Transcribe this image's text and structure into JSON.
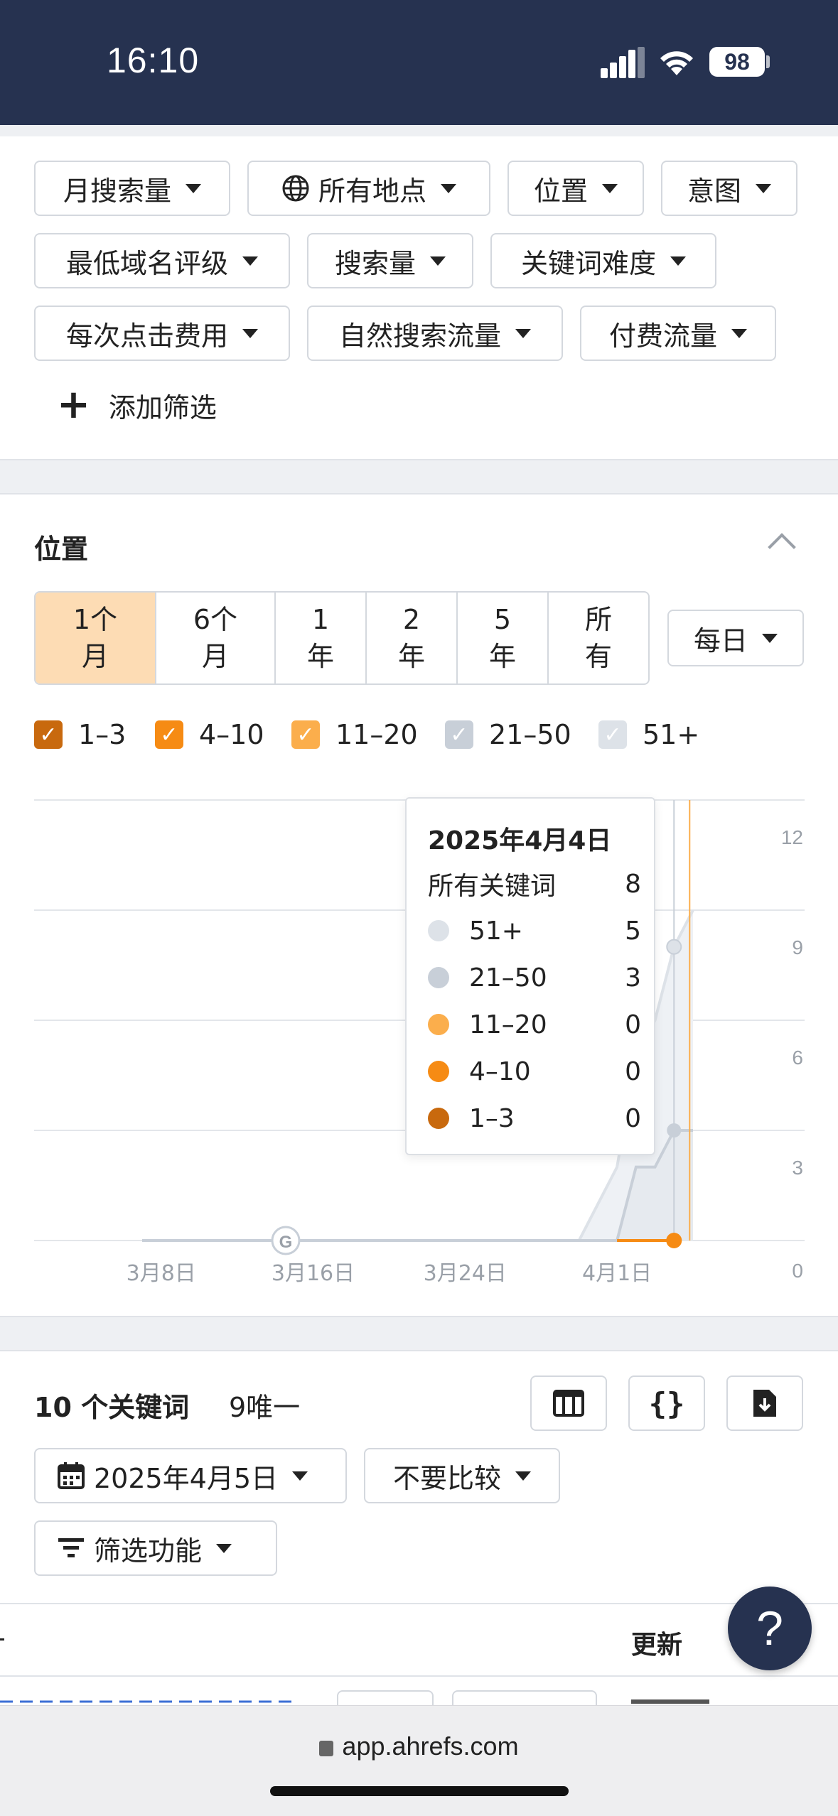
{
  "status_bar": {
    "time": "16:10",
    "battery": "98"
  },
  "filters": {
    "monthly_volume": "月搜索量",
    "all_locations": "所有地点",
    "position": "位置",
    "intent": "意图",
    "min_dr": "最低域名评级",
    "volume": "搜索量",
    "kd": "关键词难度",
    "cpc": "每次点击费用",
    "organic_traffic": "自然搜索流量",
    "paid_traffic": "付费流量",
    "add_filter": "添加筛选"
  },
  "positions": {
    "title": "位置",
    "ranges": [
      {
        "l1": "1个",
        "l2": "月"
      },
      {
        "l1": "6个",
        "l2": "月"
      },
      {
        "l1": "1",
        "l2": "年"
      },
      {
        "l1": "2",
        "l2": "年"
      },
      {
        "l1": "5",
        "l2": "年"
      },
      {
        "l1": "所",
        "l2": "有"
      }
    ],
    "interval": "每日",
    "legend": [
      {
        "label": "1–3",
        "color": "#c8690e",
        "checked": true
      },
      {
        "label": "4–10",
        "color": "#f68b14",
        "checked": true
      },
      {
        "label": "11–20",
        "color": "#fbae4c",
        "checked": true
      },
      {
        "label": "21–50",
        "color": "#c8cfd8",
        "checked": true
      },
      {
        "label": "51+",
        "color": "#dde2e8",
        "checked": true
      }
    ]
  },
  "chart_data": {
    "type": "area",
    "x_ticks": [
      "3月8日",
      "3月16日",
      "3月24日",
      "4月1日"
    ],
    "y_ticks": [
      "0",
      "3",
      "6",
      "9",
      "12"
    ],
    "ylim": [
      0,
      12
    ],
    "grid": true,
    "stacked": true,
    "x": [
      "3月7日",
      "3月8日",
      "3月9日",
      "3月10日",
      "3月11日",
      "3月12日",
      "3月13日",
      "3月14日",
      "3月15日",
      "3月16日",
      "3月17日",
      "3月18日",
      "3月19日",
      "3月20日",
      "3月21日",
      "3月22日",
      "3月23日",
      "3月24日",
      "3月25日",
      "3月26日",
      "3月27日",
      "3月28日",
      "3月29日",
      "3月30日",
      "3月31日",
      "4月1日",
      "4月2日",
      "4月3日",
      "4月4日",
      "4月5日"
    ],
    "series": [
      {
        "name": "21–50",
        "color": "#c8cfd8",
        "values": [
          0,
          0,
          0,
          0,
          0,
          0,
          0,
          0,
          0,
          0,
          0,
          0,
          0,
          0,
          0,
          0,
          0,
          0,
          0,
          0,
          0,
          0,
          0,
          0,
          0,
          0,
          2,
          2,
          3,
          3
        ]
      },
      {
        "name": "51+",
        "color": "#dde2e8",
        "values": [
          0,
          0,
          0,
          0,
          0,
          0,
          0,
          0,
          0,
          0,
          0,
          0,
          0,
          0,
          0,
          0,
          0,
          0,
          0,
          0,
          0,
          0,
          0,
          0,
          1,
          2,
          3,
          4,
          5,
          6
        ]
      }
    ],
    "tooltip": {
      "date": "2025年4月4日",
      "total_label": "所有关键词",
      "total": "8",
      "rows": [
        {
          "label": "51+",
          "value": "5",
          "color": "#dde2e8"
        },
        {
          "label": "21–50",
          "value": "3",
          "color": "#c8cfd8"
        },
        {
          "label": "11–20",
          "value": "0",
          "color": "#fbae4c"
        },
        {
          "label": "4–10",
          "value": "0",
          "color": "#f68b14"
        },
        {
          "label": "1–3",
          "value": "0",
          "color": "#c8690e"
        }
      ]
    },
    "annotation": "G"
  },
  "keywords": {
    "count_label": "10 个关键词",
    "unique_label": "9唯一",
    "date": "2025年4月5日",
    "compare": "不要比较",
    "filter_features": "筛选功能",
    "col_updated": "更新"
  },
  "help": "?",
  "browser": {
    "url": "app.ahrefs.com"
  }
}
